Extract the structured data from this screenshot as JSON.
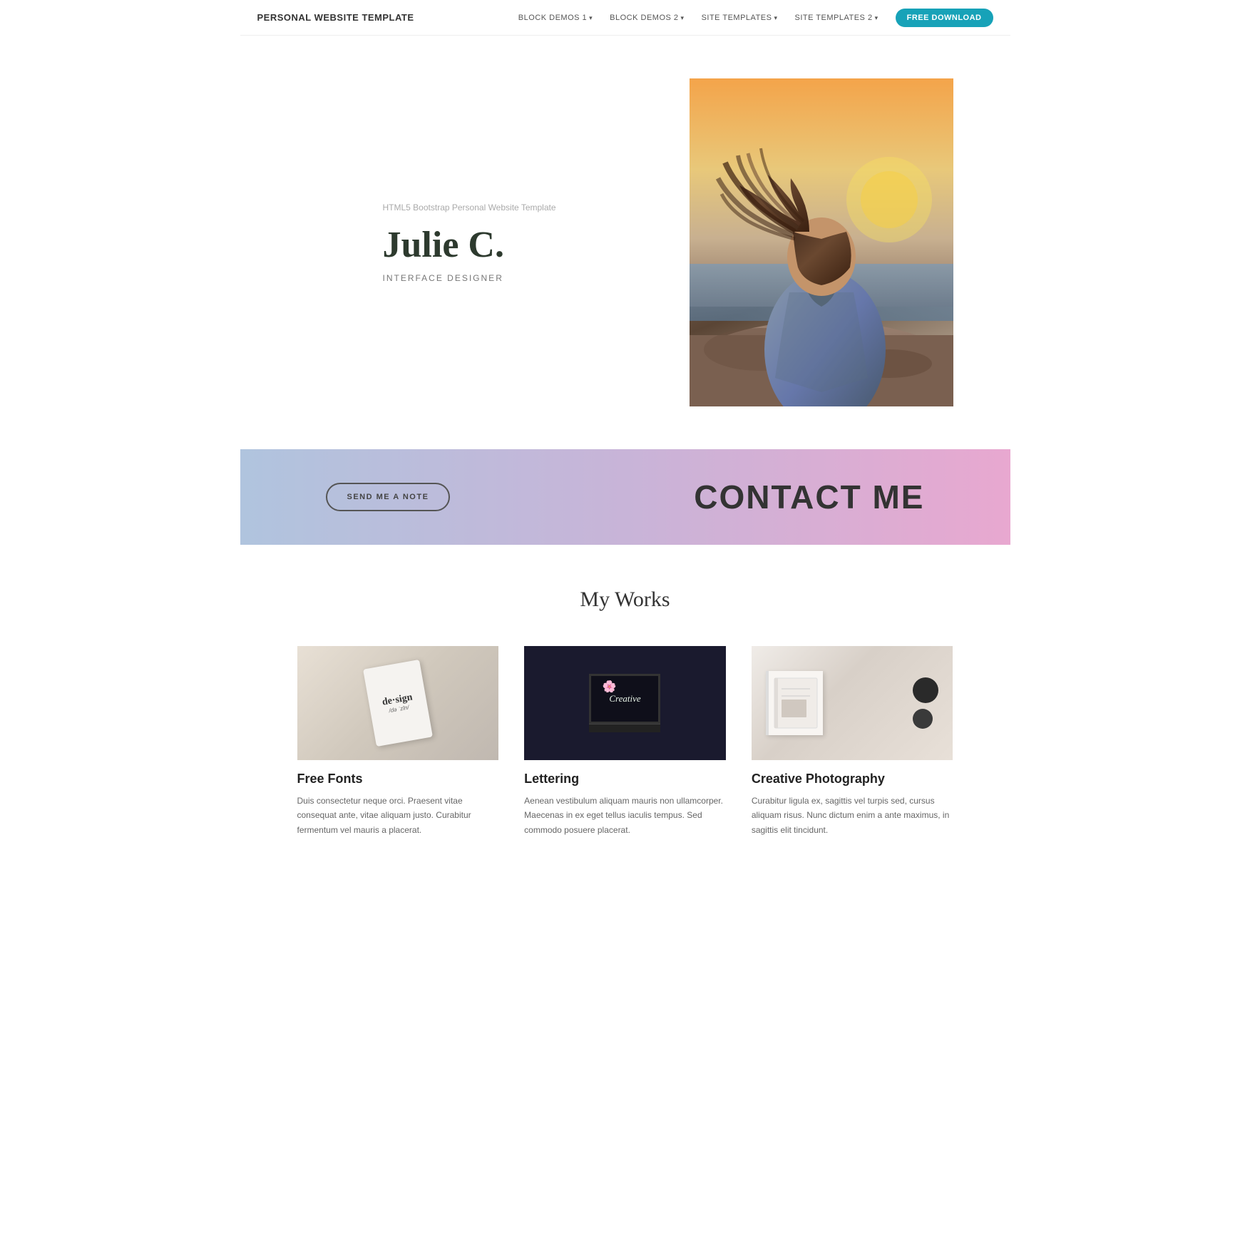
{
  "nav": {
    "brand": "PERSONAL WEBSITE TEMPLATE",
    "links": [
      {
        "label": "BLOCK DEMOS 1",
        "id": "block-demos-1"
      },
      {
        "label": "BLOCK DEMOS 2",
        "id": "block-demos-2"
      },
      {
        "label": "SITE TEMPLATES",
        "id": "site-templates"
      },
      {
        "label": "SITE TEMPLATES 2",
        "id": "site-templates-2"
      }
    ],
    "cta_label": "FREE DOWNLOAD"
  },
  "hero": {
    "sub": "HTML5 Bootstrap Personal Website Template",
    "name": "Julie C.",
    "role": "INTERFACE DESIGNER"
  },
  "contact": {
    "button_label": "SEND ME A NOTE",
    "title": "CONTACT ME"
  },
  "works": {
    "section_title": "My Works",
    "items": [
      {
        "id": "free-fonts",
        "name": "Free Fonts",
        "description": "Duis consectetur neque orci. Praesent vitae consequat ante, vitae aliquam justo. Curabitur fermentum vel mauris a placerat."
      },
      {
        "id": "lettering",
        "name": "Lettering",
        "description": "Aenean vestibulum aliquam mauris non ullamcorper. Maecenas in ex eget tellus iaculis tempus. Sed commodo posuere placerat."
      },
      {
        "id": "creative-photography",
        "name": "Creative Photography",
        "description": "Curabitur ligula ex, sagittis vel turpis sed, cursus aliquam risus. Nunc dictum enim a ante maximus, in sagittis elit tincidunt."
      }
    ]
  }
}
